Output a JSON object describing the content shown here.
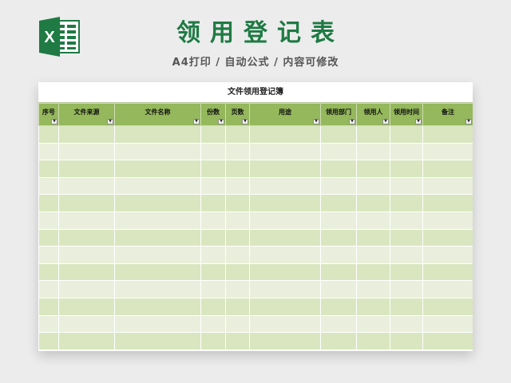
{
  "header": {
    "title": "领用登记表",
    "subtitle": "A4打印 / 自动公式 / 内容可修改",
    "logo_letter": "X"
  },
  "sheet": {
    "title": "文件领用登记簿",
    "columns": [
      {
        "label": "序号"
      },
      {
        "label": "文件来源"
      },
      {
        "label": "文件名称"
      },
      {
        "label": "份数"
      },
      {
        "label": "页数"
      },
      {
        "label": "用途"
      },
      {
        "label": "领用部门"
      },
      {
        "label": "领用人"
      },
      {
        "label": "领用时间"
      },
      {
        "label": "备注"
      }
    ],
    "row_count": 13
  },
  "colors": {
    "brand": "#1f7a44",
    "header_bg": "#94b85b",
    "row_a": "#d9e6bf",
    "row_b": "#e9efdc"
  },
  "icons": {
    "logo": "excel-icon",
    "filter": "dropdown-arrow-icon"
  }
}
